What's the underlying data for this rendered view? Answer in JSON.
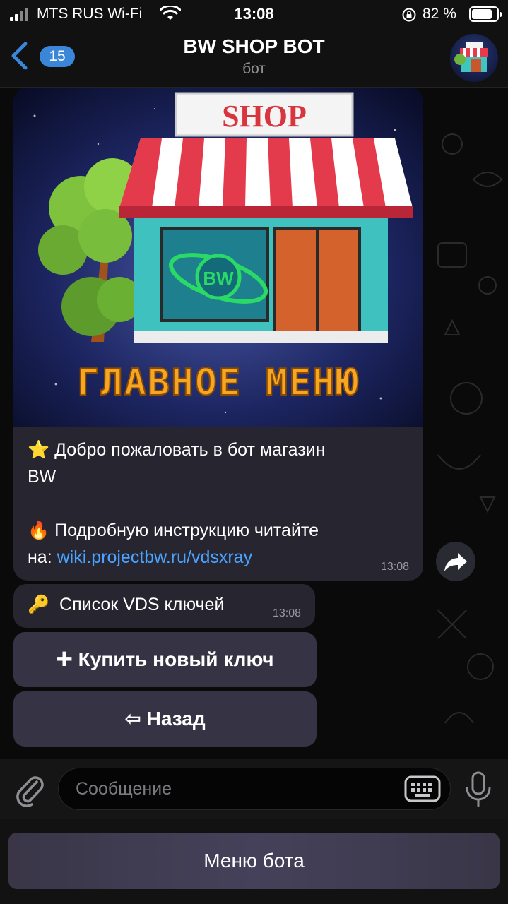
{
  "status_bar": {
    "carrier": "MTS RUS Wi-Fi",
    "time": "13:08",
    "battery_percent": "82 %",
    "battery_level": 0.82
  },
  "header": {
    "back_badge": "15",
    "title": "BW SHOP BOT",
    "subtitle": "бот"
  },
  "message": {
    "image": {
      "sign_text": "SHOP",
      "logo_text": "BW",
      "caption": "ГЛАВНОЕ МЕНЮ"
    },
    "lines": [
      {
        "emoji": "⭐",
        "text": "Добро пожаловать в бот магазин"
      },
      {
        "text": "BW"
      },
      {
        "text": ""
      },
      {
        "emoji": "🔥",
        "text": "Подробную инструкцию читайте"
      },
      {
        "text": "на: ",
        "link": "wiki.projectbw.ru/vdsxray"
      }
    ],
    "time": "13:08"
  },
  "message2": {
    "emoji": "🔑",
    "text": "Список VDS ключей",
    "time": "13:08"
  },
  "keyboard": {
    "buy_label": "✚ Купить новый ключ",
    "back_label": "⇦ Назад"
  },
  "input": {
    "placeholder": "Сообщение"
  },
  "bot_menu": {
    "label": "Меню бота"
  },
  "colors": {
    "accent": "#3a86d9",
    "link": "#4aa3ff",
    "bubble": "#262530",
    "keyboard_button": "#353344"
  },
  "icons": [
    "signal-icon",
    "wifi-icon",
    "lock-rotation-icon",
    "battery-icon",
    "back-chevron-icon",
    "share-icon",
    "paperclip-icon",
    "keyboard-icon",
    "microphone-icon"
  ]
}
